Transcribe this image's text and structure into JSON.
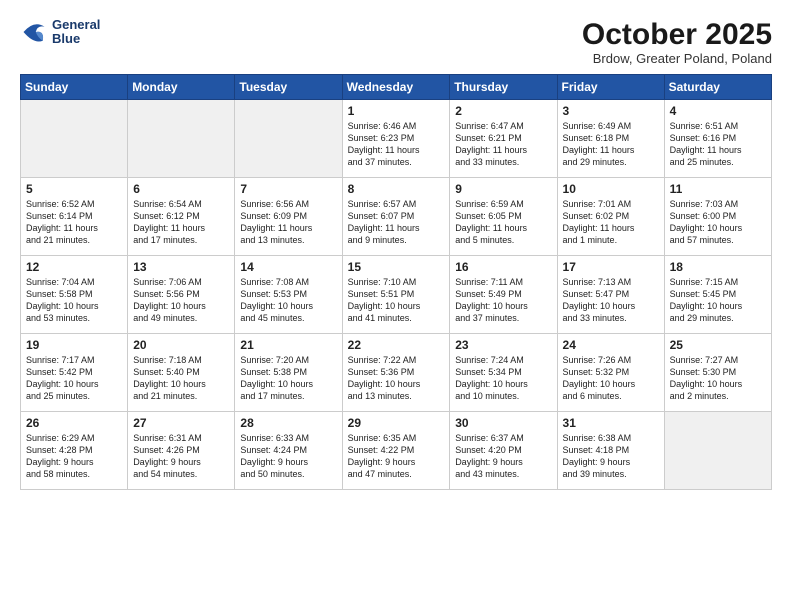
{
  "header": {
    "logo_line1": "General",
    "logo_line2": "Blue",
    "month": "October 2025",
    "location": "Brdow, Greater Poland, Poland"
  },
  "weekdays": [
    "Sunday",
    "Monday",
    "Tuesday",
    "Wednesday",
    "Thursday",
    "Friday",
    "Saturday"
  ],
  "weeks": [
    [
      {
        "day": "",
        "text": ""
      },
      {
        "day": "",
        "text": ""
      },
      {
        "day": "",
        "text": ""
      },
      {
        "day": "1",
        "text": "Sunrise: 6:46 AM\nSunset: 6:23 PM\nDaylight: 11 hours\nand 37 minutes."
      },
      {
        "day": "2",
        "text": "Sunrise: 6:47 AM\nSunset: 6:21 PM\nDaylight: 11 hours\nand 33 minutes."
      },
      {
        "day": "3",
        "text": "Sunrise: 6:49 AM\nSunset: 6:18 PM\nDaylight: 11 hours\nand 29 minutes."
      },
      {
        "day": "4",
        "text": "Sunrise: 6:51 AM\nSunset: 6:16 PM\nDaylight: 11 hours\nand 25 minutes."
      }
    ],
    [
      {
        "day": "5",
        "text": "Sunrise: 6:52 AM\nSunset: 6:14 PM\nDaylight: 11 hours\nand 21 minutes."
      },
      {
        "day": "6",
        "text": "Sunrise: 6:54 AM\nSunset: 6:12 PM\nDaylight: 11 hours\nand 17 minutes."
      },
      {
        "day": "7",
        "text": "Sunrise: 6:56 AM\nSunset: 6:09 PM\nDaylight: 11 hours\nand 13 minutes."
      },
      {
        "day": "8",
        "text": "Sunrise: 6:57 AM\nSunset: 6:07 PM\nDaylight: 11 hours\nand 9 minutes."
      },
      {
        "day": "9",
        "text": "Sunrise: 6:59 AM\nSunset: 6:05 PM\nDaylight: 11 hours\nand 5 minutes."
      },
      {
        "day": "10",
        "text": "Sunrise: 7:01 AM\nSunset: 6:02 PM\nDaylight: 11 hours\nand 1 minute."
      },
      {
        "day": "11",
        "text": "Sunrise: 7:03 AM\nSunset: 6:00 PM\nDaylight: 10 hours\nand 57 minutes."
      }
    ],
    [
      {
        "day": "12",
        "text": "Sunrise: 7:04 AM\nSunset: 5:58 PM\nDaylight: 10 hours\nand 53 minutes."
      },
      {
        "day": "13",
        "text": "Sunrise: 7:06 AM\nSunset: 5:56 PM\nDaylight: 10 hours\nand 49 minutes."
      },
      {
        "day": "14",
        "text": "Sunrise: 7:08 AM\nSunset: 5:53 PM\nDaylight: 10 hours\nand 45 minutes."
      },
      {
        "day": "15",
        "text": "Sunrise: 7:10 AM\nSunset: 5:51 PM\nDaylight: 10 hours\nand 41 minutes."
      },
      {
        "day": "16",
        "text": "Sunrise: 7:11 AM\nSunset: 5:49 PM\nDaylight: 10 hours\nand 37 minutes."
      },
      {
        "day": "17",
        "text": "Sunrise: 7:13 AM\nSunset: 5:47 PM\nDaylight: 10 hours\nand 33 minutes."
      },
      {
        "day": "18",
        "text": "Sunrise: 7:15 AM\nSunset: 5:45 PM\nDaylight: 10 hours\nand 29 minutes."
      }
    ],
    [
      {
        "day": "19",
        "text": "Sunrise: 7:17 AM\nSunset: 5:42 PM\nDaylight: 10 hours\nand 25 minutes."
      },
      {
        "day": "20",
        "text": "Sunrise: 7:18 AM\nSunset: 5:40 PM\nDaylight: 10 hours\nand 21 minutes."
      },
      {
        "day": "21",
        "text": "Sunrise: 7:20 AM\nSunset: 5:38 PM\nDaylight: 10 hours\nand 17 minutes."
      },
      {
        "day": "22",
        "text": "Sunrise: 7:22 AM\nSunset: 5:36 PM\nDaylight: 10 hours\nand 13 minutes."
      },
      {
        "day": "23",
        "text": "Sunrise: 7:24 AM\nSunset: 5:34 PM\nDaylight: 10 hours\nand 10 minutes."
      },
      {
        "day": "24",
        "text": "Sunrise: 7:26 AM\nSunset: 5:32 PM\nDaylight: 10 hours\nand 6 minutes."
      },
      {
        "day": "25",
        "text": "Sunrise: 7:27 AM\nSunset: 5:30 PM\nDaylight: 10 hours\nand 2 minutes."
      }
    ],
    [
      {
        "day": "26",
        "text": "Sunrise: 6:29 AM\nSunset: 4:28 PM\nDaylight: 9 hours\nand 58 minutes."
      },
      {
        "day": "27",
        "text": "Sunrise: 6:31 AM\nSunset: 4:26 PM\nDaylight: 9 hours\nand 54 minutes."
      },
      {
        "day": "28",
        "text": "Sunrise: 6:33 AM\nSunset: 4:24 PM\nDaylight: 9 hours\nand 50 minutes."
      },
      {
        "day": "29",
        "text": "Sunrise: 6:35 AM\nSunset: 4:22 PM\nDaylight: 9 hours\nand 47 minutes."
      },
      {
        "day": "30",
        "text": "Sunrise: 6:37 AM\nSunset: 4:20 PM\nDaylight: 9 hours\nand 43 minutes."
      },
      {
        "day": "31",
        "text": "Sunrise: 6:38 AM\nSunset: 4:18 PM\nDaylight: 9 hours\nand 39 minutes."
      },
      {
        "day": "",
        "text": ""
      }
    ]
  ]
}
